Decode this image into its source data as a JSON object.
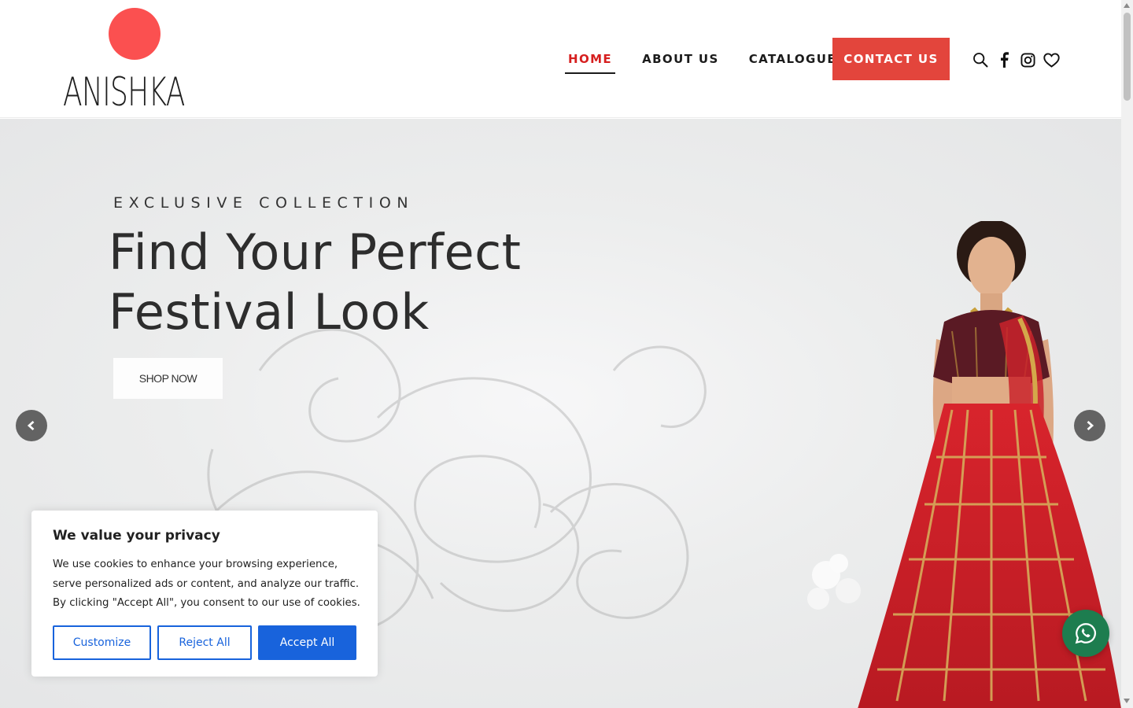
{
  "brand": {
    "name": "ANISHKA",
    "dot_color": "#fb5050"
  },
  "nav": {
    "items": [
      {
        "label": "HOME",
        "active": true
      },
      {
        "label": "ABOUT US",
        "active": false
      },
      {
        "label": "CATALOGUE",
        "active": false
      }
    ],
    "contact_label": "CONTACT US",
    "contact_color": "#e3453c",
    "icons": [
      "search-icon",
      "facebook-icon",
      "instagram-icon",
      "heart-icon"
    ]
  },
  "hero": {
    "eyebrow": "EXCLUSIVE COLLECTION",
    "title_line1": "Find Your Perfect",
    "title_line2": "Festival Look",
    "cta_label": "SHOP NOW",
    "prev_icon": "chevron-left-icon",
    "next_icon": "chevron-right-icon"
  },
  "cookie": {
    "title": "We value your privacy",
    "text": "We use cookies to enhance your browsing experience, serve personalized ads or content, and analyze our traffic. By clicking \"Accept All\", you consent to our use of cookies.",
    "customize_label": "Customize",
    "reject_label": "Reject All",
    "accept_label": "Accept All",
    "accent_color": "#1863dc"
  },
  "whatsapp": {
    "icon": "whatsapp-icon",
    "color": "#1d7d4f"
  }
}
